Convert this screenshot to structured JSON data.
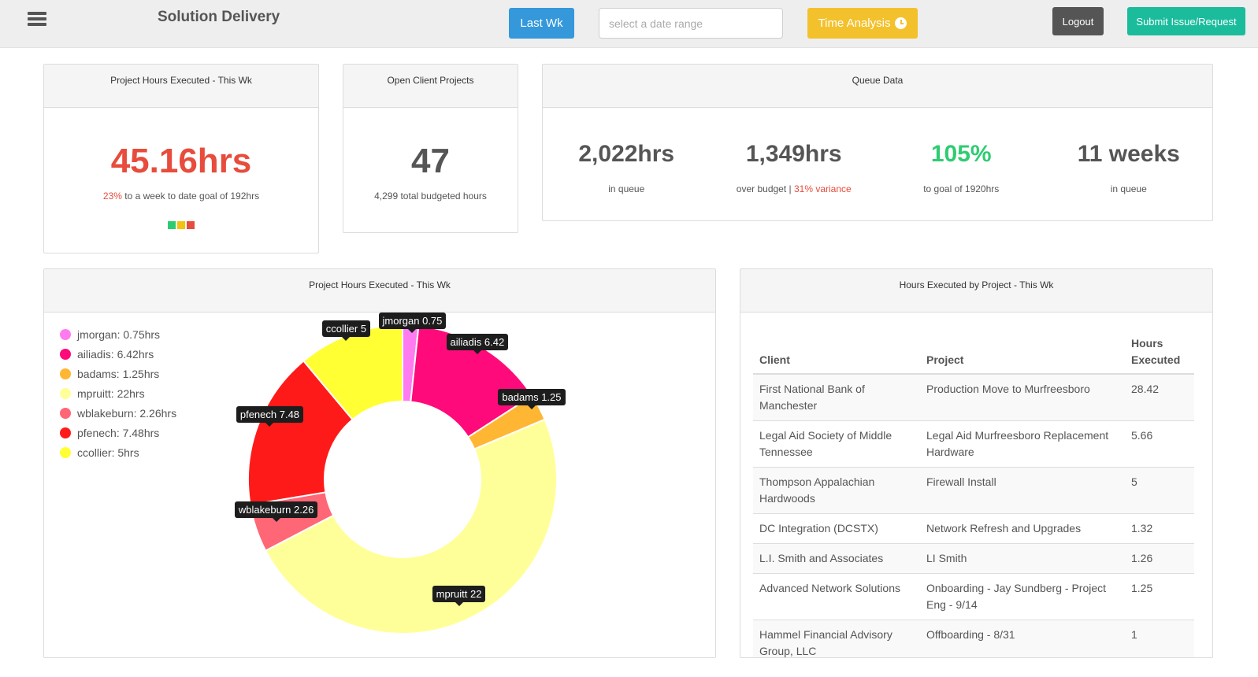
{
  "header": {
    "app_title": "Solution Delivery",
    "last_wk_label": "Last Wk",
    "date_placeholder": "select a date range",
    "time_analysis_label": "Time Analysis",
    "logout_label": "Logout",
    "submit_label": "Submit Issue/Request"
  },
  "hours_card": {
    "title": "Project Hours Executed - This Wk",
    "value": "45.16hrs",
    "pct": "23%",
    "goal_text": " to a week to date goal of 192hrs",
    "status_colors": [
      "#2ecc71",
      "#f1c40f",
      "#e74c3c"
    ]
  },
  "projects_card": {
    "title": "Open Client Projects",
    "value": "47",
    "sub": "4,299 total budgeted hours"
  },
  "queue_card": {
    "title": "Queue Data",
    "items": [
      {
        "value": "2,022hrs",
        "label": "in queue"
      },
      {
        "value": "1,349hrs",
        "label": "over budget | ",
        "extra": "31% variance"
      },
      {
        "value": "105%",
        "label": "to goal of 1920hrs"
      },
      {
        "value": "11 weeks",
        "label": "in queue"
      }
    ]
  },
  "donut_card": {
    "title": "Project Hours Executed - This Wk"
  },
  "chart_data": {
    "type": "pie",
    "donut": true,
    "categories": [
      "jmorgan",
      "ailiadis",
      "badams",
      "mpruitt",
      "wblakeburn",
      "pfenech",
      "ccollier"
    ],
    "values": [
      0.75,
      6.42,
      1.25,
      22,
      2.26,
      7.48,
      5
    ],
    "colors": [
      "#ff7cf0",
      "#ff0a7a",
      "#ffb733",
      "#ffff99",
      "#ff6676",
      "#ff1a1a",
      "#ffff33"
    ],
    "legend_labels": [
      "jmorgan: 0.75hrs",
      "ailiadis: 6.42hrs",
      "badams: 1.25hrs",
      "mpruitt: 22hrs",
      "wblakeburn: 2.26hrs",
      "pfenech: 7.48hrs",
      "ccollier: 5hrs"
    ],
    "tooltip_labels": [
      "jmorgan 0.75",
      "ailiadis 6.42",
      "badams 1.25",
      "mpruitt 22",
      "wblakeburn 2.26",
      "pfenech 7.48",
      "ccollier 5"
    ],
    "legend_position": "left"
  },
  "table_card": {
    "title": "Hours Executed by Project - This Wk",
    "columns": [
      "Client",
      "Project",
      "Hours Executed"
    ],
    "rows": [
      [
        "First National Bank of Manchester",
        "Production Move to Murfreesboro",
        "28.42"
      ],
      [
        "Legal Aid Society of Middle Tennessee",
        "Legal Aid Murfreesboro Replacement Hardware",
        "5.66"
      ],
      [
        "Thompson Appalachian Hardwoods",
        "Firewall Install",
        "5"
      ],
      [
        "DC Integration (DCSTX)",
        "Network Refresh and Upgrades",
        "1.32"
      ],
      [
        "L.I. Smith and Associates",
        "LI Smith",
        "1.26"
      ],
      [
        "Advanced Network Solutions",
        "Onboarding - Jay Sundberg - Project Eng - 9/14",
        "1.25"
      ],
      [
        "Hammel Financial Advisory Group, LLC",
        "Offboarding - 8/31",
        "1"
      ]
    ]
  }
}
